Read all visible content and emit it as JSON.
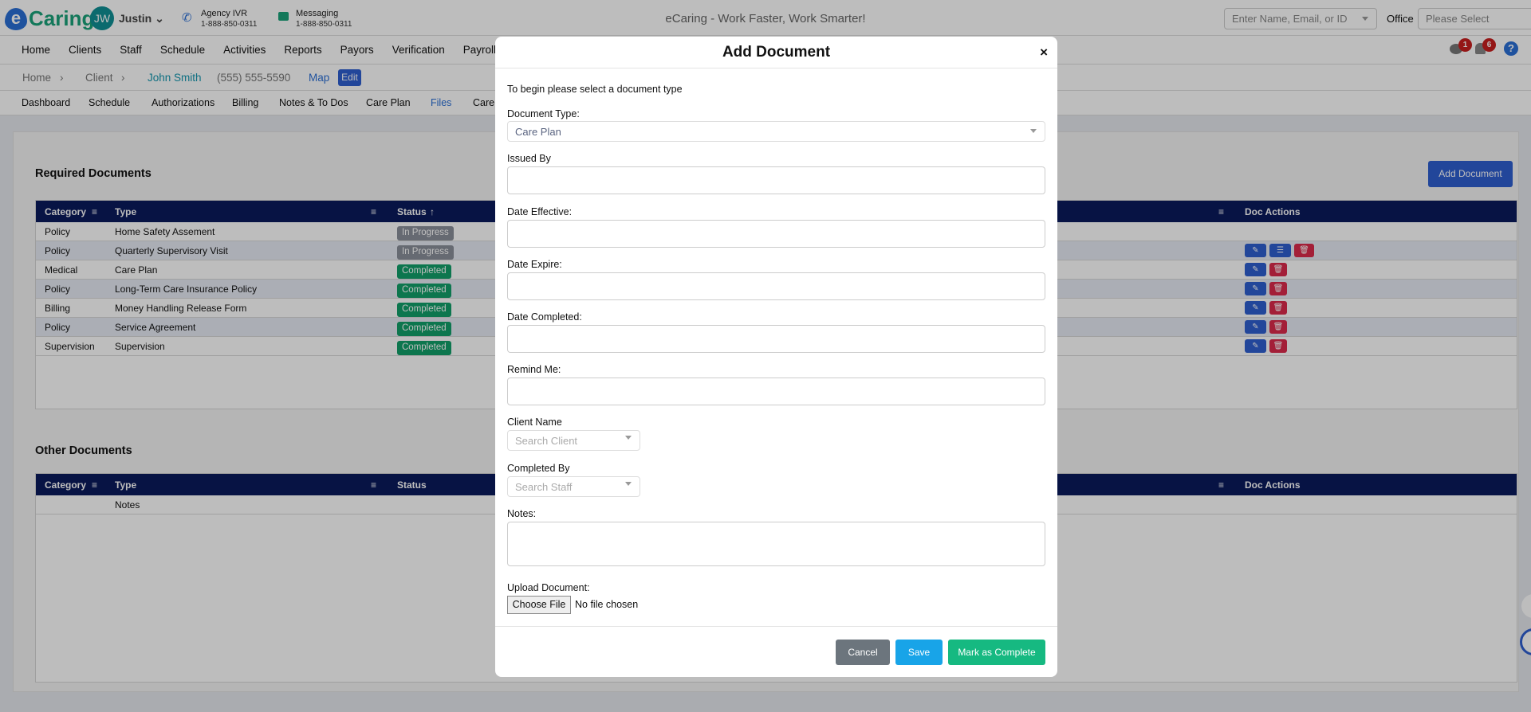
{
  "topbar": {
    "logo": "Caring",
    "logo_mark": "e",
    "avatar_initials": "JW",
    "user": "Justin",
    "ivr_label": "Agency IVR",
    "ivr_phone": "1-888-850-0311",
    "msg_label": "Messaging",
    "msg_phone": "1-888-850-0311",
    "title": "eCaring - Work Faster, Work Smarter!",
    "search_placeholder": "Enter Name, Email, or ID",
    "office_label": "Office",
    "office_placeholder": "Please Select"
  },
  "nav": [
    "Home",
    "Clients",
    "Staff",
    "Schedule",
    "Activities",
    "Reports",
    "Payors",
    "Verification",
    "Payroll"
  ],
  "badges": {
    "messages": "1",
    "notifications": "6"
  },
  "breadcrumb": {
    "home": "Home",
    "client": "Client",
    "name": "John Smith",
    "phone": "(555) 555-5590",
    "map": "Map",
    "edit": "Edit"
  },
  "subnav": [
    "Dashboard",
    "Schedule",
    "Authorizations",
    "Billing",
    "Notes & To Dos",
    "Care Plan",
    "Files",
    "Care"
  ],
  "required": {
    "title": "Required Documents",
    "add_button": "Add Document",
    "headers": {
      "category": "Category",
      "type": "Type",
      "status": "Status",
      "actions": "Doc Actions"
    },
    "rows": [
      {
        "category": "Policy",
        "type": "Home Safety Assement",
        "status": "In Progress"
      },
      {
        "category": "Policy",
        "type": "Quarterly Supervisory Visit",
        "status": "In Progress"
      },
      {
        "category": "Medical",
        "type": "Care Plan",
        "status": "Completed"
      },
      {
        "category": "Policy",
        "type": "Long-Term Care Insurance Policy",
        "status": "Completed"
      },
      {
        "category": "Billing",
        "type": "Money Handling Release Form",
        "status": "Completed"
      },
      {
        "category": "Policy",
        "type": "Service Agreement",
        "status": "Completed"
      },
      {
        "category": "Supervision",
        "type": "Supervision",
        "status": "Completed"
      }
    ]
  },
  "other": {
    "title": "Other Documents",
    "headers": {
      "category": "Category",
      "type": "Type",
      "status": "Status",
      "actions": "Doc Actions"
    },
    "rows": [
      {
        "type": "Notes"
      }
    ]
  },
  "modal": {
    "title": "Add Document",
    "intro": "To begin please select a document type",
    "doc_type_label": "Document Type:",
    "doc_type_value": "Care Plan",
    "issued_by": "Issued By",
    "date_effective": "Date Effective:",
    "date_expire": "Date Expire:",
    "date_completed": "Date Completed:",
    "remind_me": "Remind Me:",
    "client_name": "Client Name",
    "client_placeholder": "Search Client",
    "completed_by": "Completed By",
    "staff_placeholder": "Search Staff",
    "notes": "Notes:",
    "upload": "Upload Document:",
    "choose_file": "Choose File",
    "no_file": "No file chosen",
    "cancel": "Cancel",
    "save": "Save",
    "complete": "Mark as Complete"
  },
  "colors": {
    "header": "#0a1a5c",
    "completed": "#12a06a",
    "in_progress": "#8a8f9a",
    "primary": "#2f5fd0",
    "danger": "#dc2a4c",
    "save": "#18a4e8",
    "complete": "#16b981",
    "cancel": "#6c757d"
  }
}
